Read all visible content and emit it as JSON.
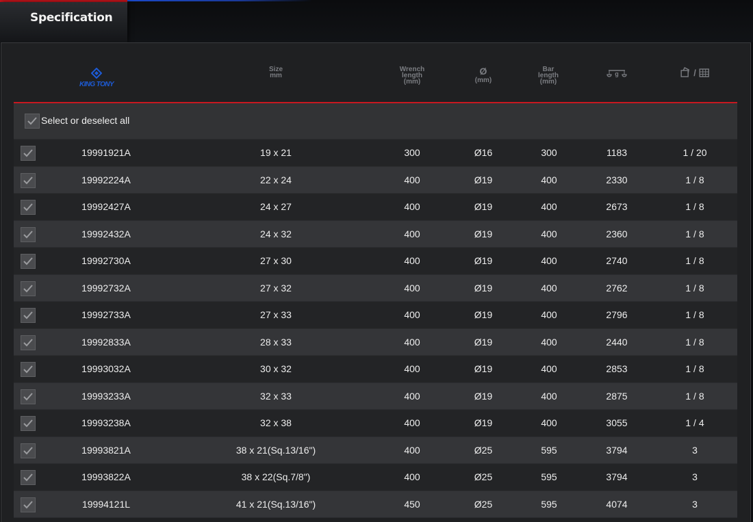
{
  "tab": {
    "title": "Specification"
  },
  "header": {
    "brand": "KING TONY",
    "size": [
      "Size",
      "mm"
    ],
    "wrench_length": [
      "Wrench",
      "length",
      "(mm)"
    ],
    "diameter": [
      "Ø",
      "(mm)"
    ],
    "bar_length": [
      "Bar",
      "length",
      "(mm)"
    ],
    "weight_icon": "scale-icon",
    "pack_icon": "package-box-icon",
    "pack_sep": "/"
  },
  "select_all": {
    "label": "Select or deselect all",
    "checked": true
  },
  "rows": [
    {
      "code": "19991921A",
      "size": "19 x 21",
      "wrench": "300",
      "dia": "Ø16",
      "bar": "300",
      "weight": "1183",
      "pack": "1 / 20"
    },
    {
      "code": "19992224A",
      "size": "22 x 24",
      "wrench": "400",
      "dia": "Ø19",
      "bar": "400",
      "weight": "2330",
      "pack": "1 / 8"
    },
    {
      "code": "19992427A",
      "size": "24 x 27",
      "wrench": "400",
      "dia": "Ø19",
      "bar": "400",
      "weight": "2673",
      "pack": "1 / 8"
    },
    {
      "code": "19992432A",
      "size": "24 x 32",
      "wrench": "400",
      "dia": "Ø19",
      "bar": "400",
      "weight": "2360",
      "pack": "1 / 8"
    },
    {
      "code": "19992730A",
      "size": "27 x 30",
      "wrench": "400",
      "dia": "Ø19",
      "bar": "400",
      "weight": "2740",
      "pack": "1 / 8"
    },
    {
      "code": "19992732A",
      "size": "27 x 32",
      "wrench": "400",
      "dia": "Ø19",
      "bar": "400",
      "weight": "2762",
      "pack": "1 / 8"
    },
    {
      "code": "19992733A",
      "size": "27 x 33",
      "wrench": "400",
      "dia": "Ø19",
      "bar": "400",
      "weight": "2796",
      "pack": "1 / 8"
    },
    {
      "code": "19992833A",
      "size": "28 x 33",
      "wrench": "400",
      "dia": "Ø19",
      "bar": "400",
      "weight": "2440",
      "pack": "1 / 8"
    },
    {
      "code": "19993032A",
      "size": "30 x 32",
      "wrench": "400",
      "dia": "Ø19",
      "bar": "400",
      "weight": "2853",
      "pack": "1 / 8"
    },
    {
      "code": "19993233A",
      "size": "32 x 33",
      "wrench": "400",
      "dia": "Ø19",
      "bar": "400",
      "weight": "2875",
      "pack": "1 / 8"
    },
    {
      "code": "19993238A",
      "size": "32 x 38",
      "wrench": "400",
      "dia": "Ø19",
      "bar": "400",
      "weight": "3055",
      "pack": "1 / 4"
    },
    {
      "code": "19993821A",
      "size": "38 x 21(Sq.13/16\")",
      "wrench": "400",
      "dia": "Ø25",
      "bar": "595",
      "weight": "3794",
      "pack": "3"
    },
    {
      "code": "19993822A",
      "size": "38 x 22(Sq.7/8\")",
      "wrench": "400",
      "dia": "Ø25",
      "bar": "595",
      "weight": "3794",
      "pack": "3"
    },
    {
      "code": "19994121L",
      "size": "41 x 21(Sq.13/16\")",
      "wrench": "450",
      "dia": "Ø25",
      "bar": "595",
      "weight": "4074",
      "pack": "3"
    }
  ],
  "colors": {
    "accent_red": "#c81820",
    "brand_blue": "#1d5bd6"
  }
}
